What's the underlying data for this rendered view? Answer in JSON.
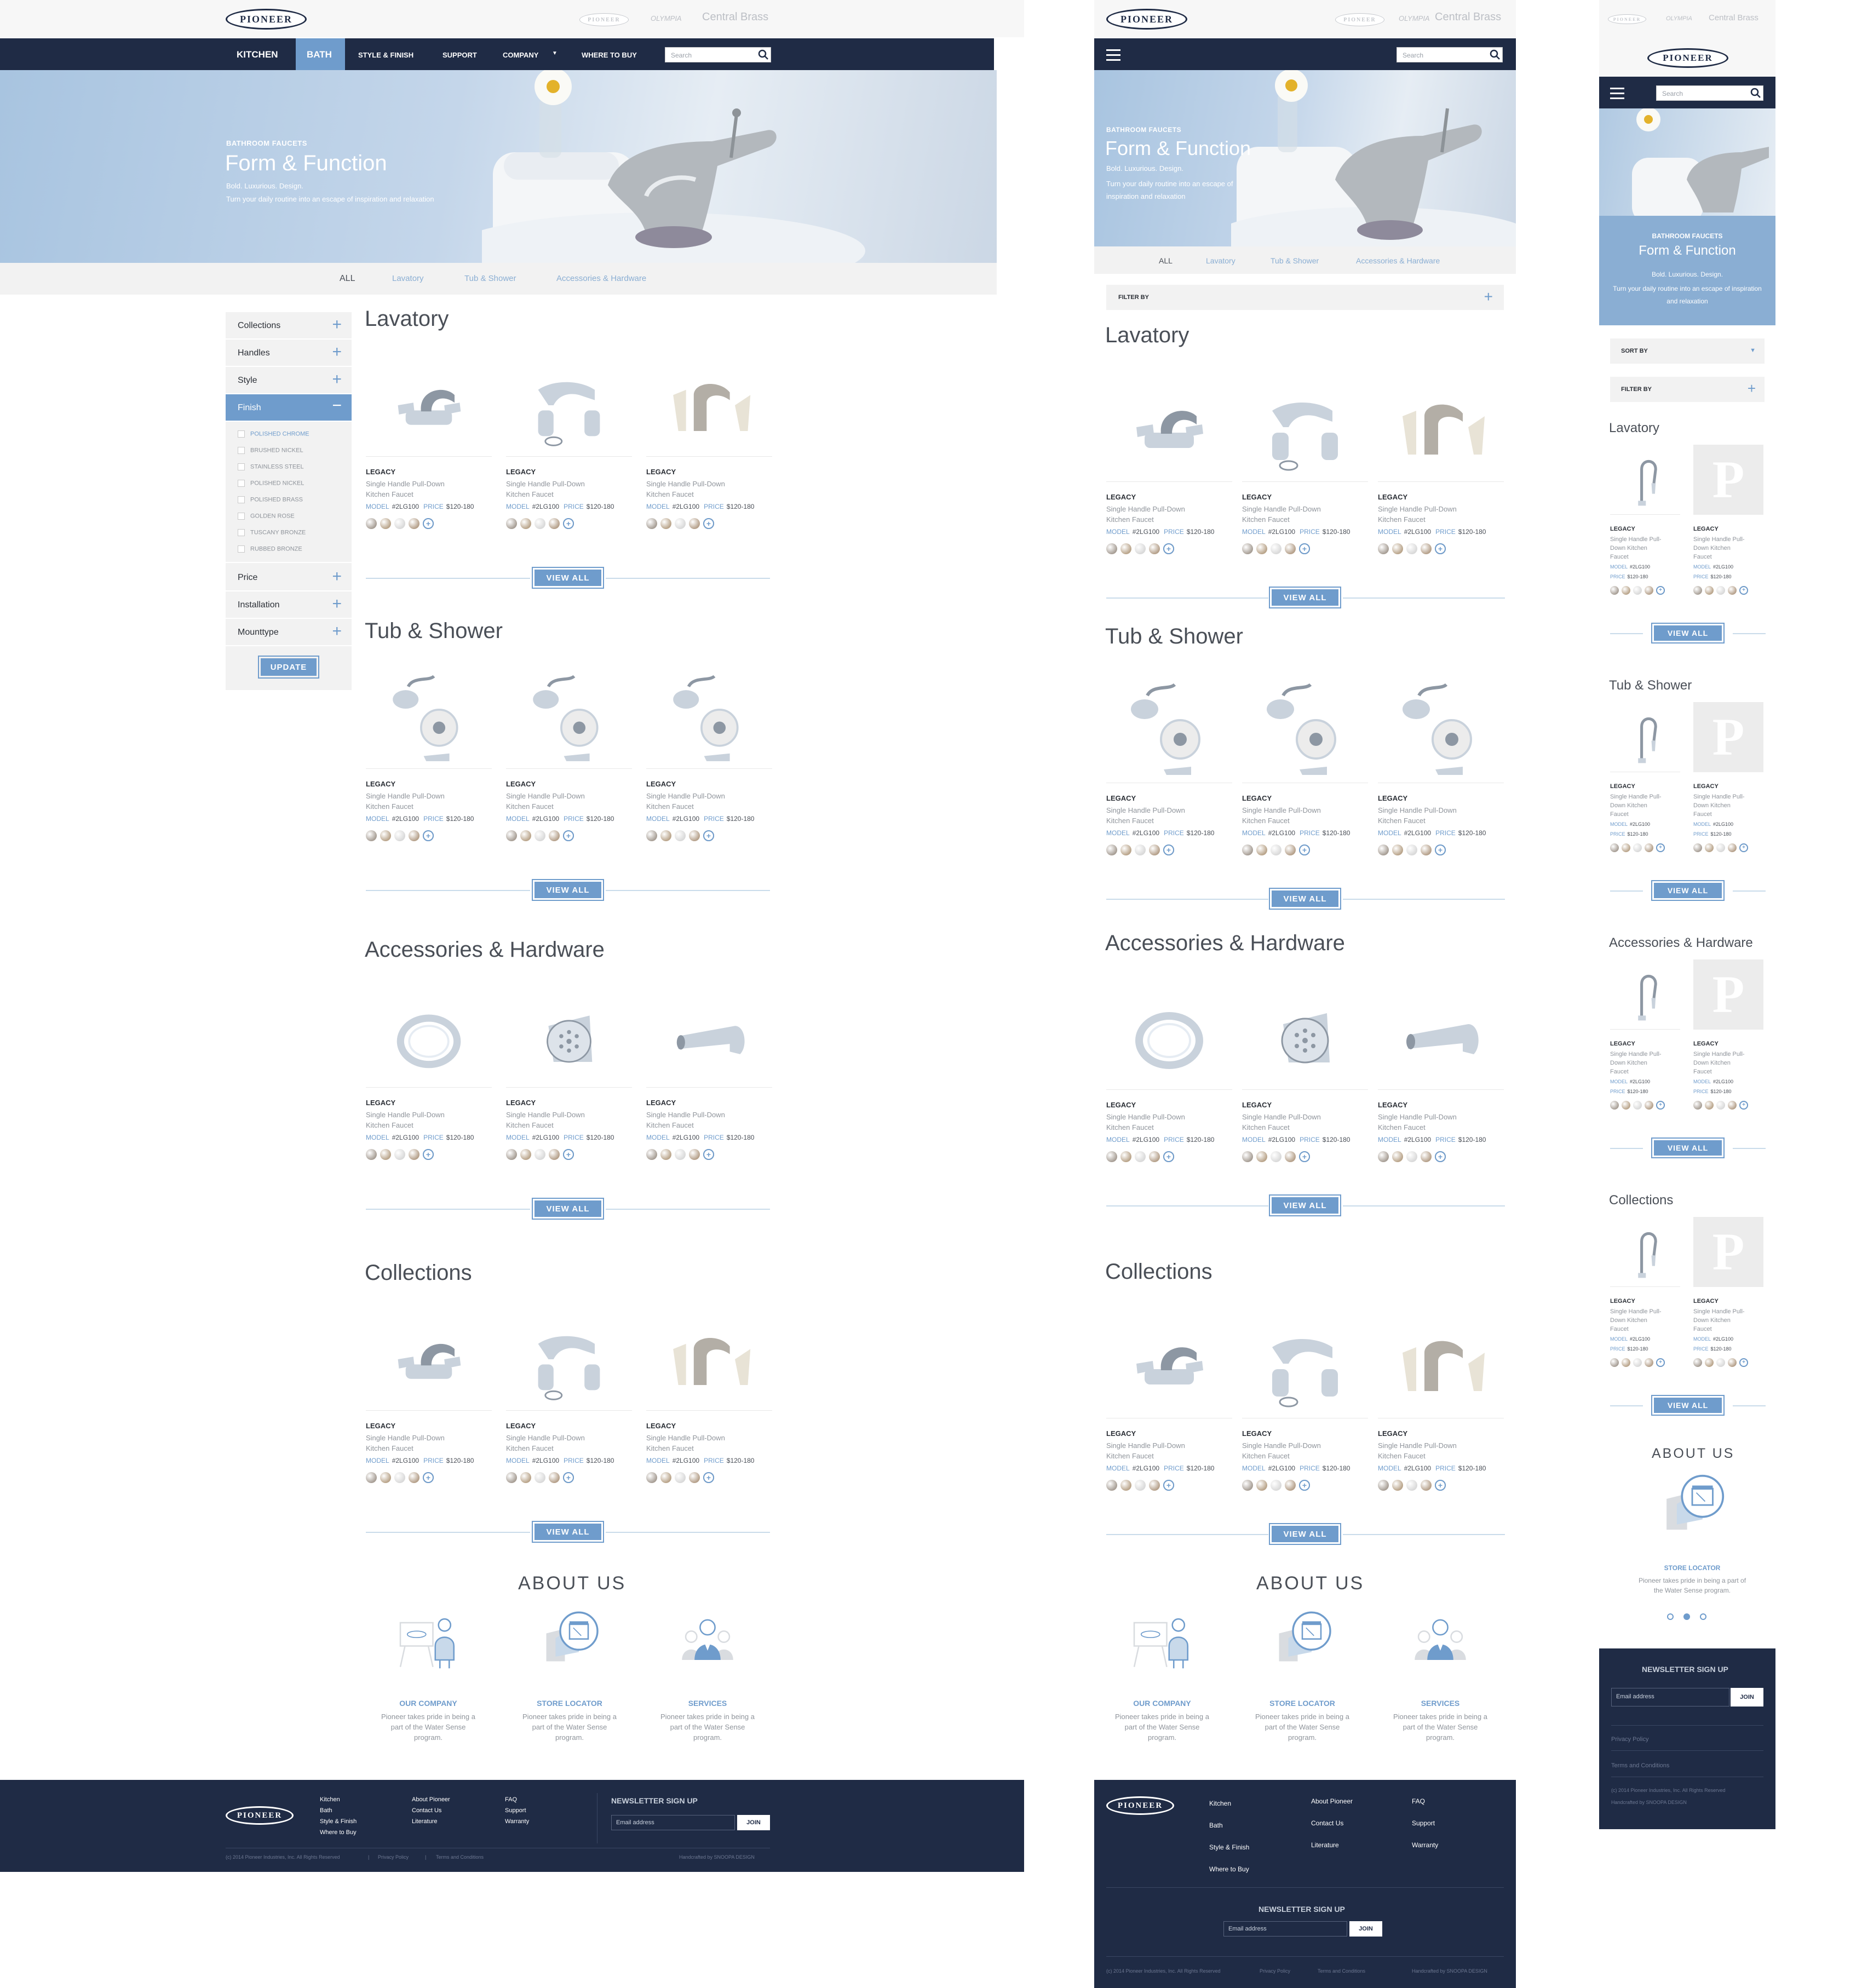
{
  "brands": {
    "logo": "PIONEER",
    "b2": "PIONEER",
    "b3": "OLYMPIA",
    "b4": "Central Brass"
  },
  "nav": {
    "kitchen": "KITCHEN",
    "bath": "BATH",
    "style": "STYLE & FINISH",
    "support": "SUPPORT",
    "company": "COMPANY",
    "where": "WHERE TO BUY",
    "search_ph": "Search"
  },
  "hero": {
    "sub": "BATHROOM FAUCETS",
    "title": "Form & Function",
    "line1": "Bold. Luxurious. Design.",
    "line2": "Turn your daily routine into an escape of inspiration and relaxation",
    "line2_short": "Turn your daily routine into an escape of inspiration and relaxation"
  },
  "tabs": [
    "ALL",
    "Lavatory",
    "Tub & Shower",
    "Accessories & Hardware"
  ],
  "filters": {
    "items": [
      "Collections",
      "Handles",
      "Style",
      "Finish",
      "Price",
      "Installation",
      "Mounttype"
    ],
    "finish_options": [
      "POLISHED CHROME",
      "BRUSHED NICKEL",
      "STAINLESS STEEL",
      "POLISHED NICKEL",
      "POLISHED BRASS",
      "GOLDEN ROSE",
      "TUSCANY BRONZE",
      "RUBBED BRONZE"
    ],
    "update": "UPDATE",
    "filter_by": "FILTER BY",
    "sort_by": "SORT BY"
  },
  "sections": [
    "Lavatory",
    "Tub & Shower",
    "Accessories & Hardware",
    "Collections"
  ],
  "card": {
    "brand": "LEGACY",
    "name1": "Single Handle Pull-Down",
    "name2": "Kitchen Faucet",
    "name_m1": "Single Handle Pull-",
    "name_m2": "Down Kitchen",
    "name_m3": "Faucet",
    "model_lbl": "MODEL",
    "model": "#2LG100",
    "price_lbl": "PRICE",
    "price": "$120-180"
  },
  "view_all": "VIEW ALL",
  "about": {
    "title": "ABOUT US",
    "items": [
      {
        "t": "OUR COMPANY"
      },
      {
        "t": "STORE LOCATOR"
      },
      {
        "t": "SERVICES"
      }
    ],
    "p1": "Pioneer takes pride in being a",
    "p2": "part of the Water Sense",
    "p3": "program.",
    "pm1": "Pioneer takes pride in being a part of",
    "pm2": "the Water Sense program."
  },
  "footer": {
    "col1": [
      "Kitchen",
      "Bath",
      "Style & Finish",
      "Where to Buy"
    ],
    "col2": [
      "About Pioneer",
      "Contact Us",
      "Literature"
    ],
    "col3": [
      "FAQ",
      "Support",
      "Warranty"
    ],
    "news": "NEWSLETTER SIGN UP",
    "email_ph": "Email address",
    "join": "JOIN",
    "copy": "(c) 2014 Pioneer Industries, Inc. All Rights Reserved",
    "privacy": "Privacy Policy",
    "terms": "Terms and Conditions",
    "hand": "Handcrafted by SNOOPA DESIGN",
    "terms_m": "Terms and Conditions"
  },
  "swatch_colors": [
    "#a79e95",
    "#b9a48a",
    "#d9d9d9",
    "#b5a08a",
    "#8c7b6b"
  ]
}
